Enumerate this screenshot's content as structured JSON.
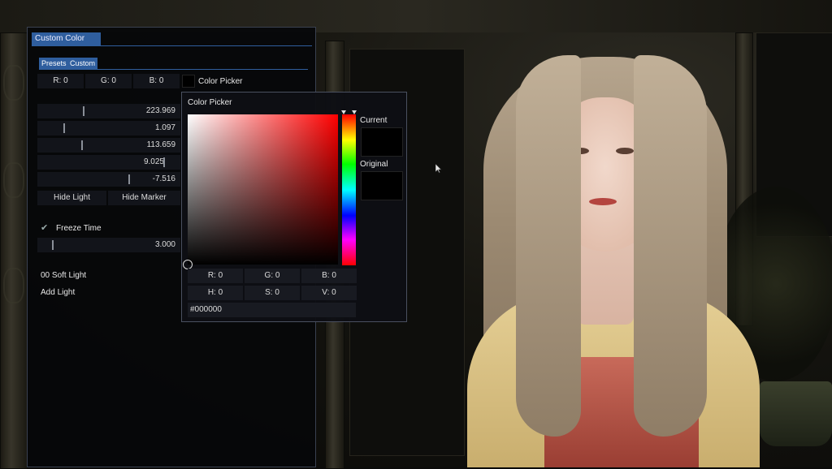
{
  "window": {
    "title": "Custom Color",
    "tabs": [
      "Presets",
      "Custom"
    ],
    "rgb": {
      "r": "R: 0",
      "g": "G: 0",
      "b": "B: 0"
    },
    "color_picker_label": "Color Picker",
    "sliders": [
      "223.969",
      "1.097",
      "113.659",
      "9.025",
      "-7.516"
    ],
    "hide_light": "Hide Light",
    "hide_marker": "Hide Marker",
    "freeze_time": "Freeze Time",
    "freeze_value": "3.000",
    "light_item": "00 Soft Light",
    "add_light": "Add Light"
  },
  "picker": {
    "title": "Color Picker",
    "current": "Current",
    "original": "Original",
    "r": "R: 0",
    "g": "G: 0",
    "b": "B: 0",
    "h": "H: 0",
    "s": "S: 0",
    "v": "V: 0",
    "hex": "#000000",
    "current_color": "#000000",
    "original_color": "#000000"
  },
  "icons": {
    "check": "checkmark-icon",
    "pointer": "mouse-pointer-icon"
  }
}
